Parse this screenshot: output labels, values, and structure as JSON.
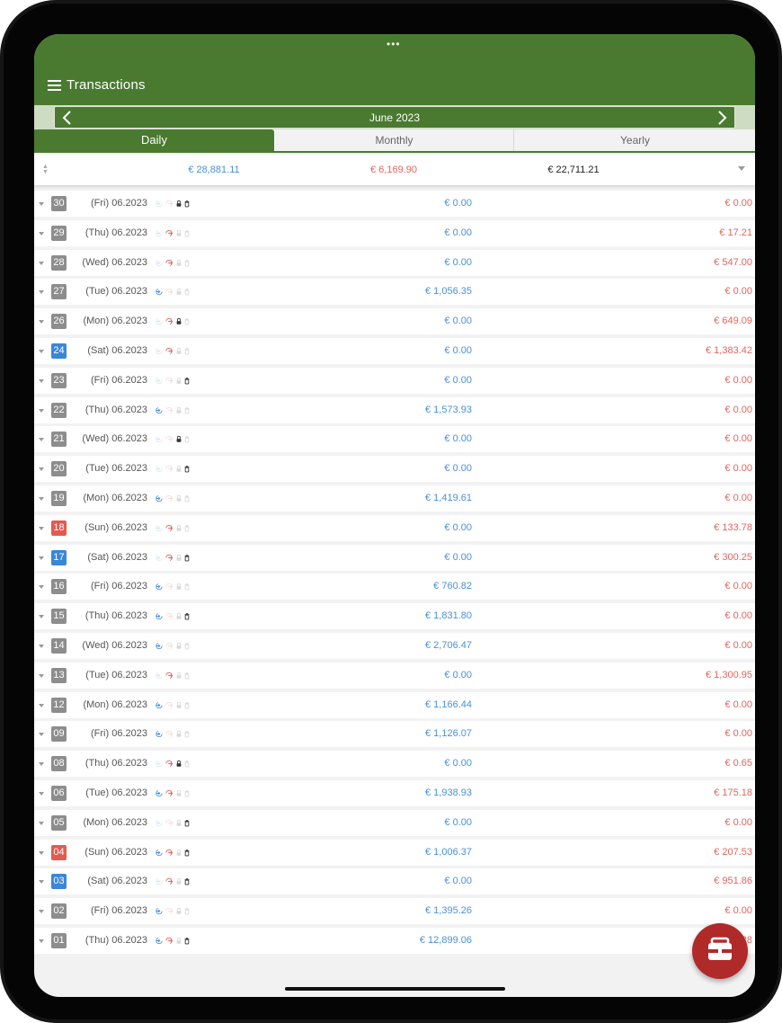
{
  "app": {
    "title": "Transactions"
  },
  "navigation": {
    "month_label": "June 2023"
  },
  "tabs": [
    {
      "label": "Daily",
      "selected": true
    },
    {
      "label": "Monthly",
      "selected": false
    },
    {
      "label": "Yearly",
      "selected": false
    }
  ],
  "summary": {
    "income": "€ 28,881.11",
    "expense": "€ 6,169.90",
    "total": "€ 22,711.21"
  },
  "colors": {
    "brand": "#4a7a30",
    "income": "#4a90d9",
    "expense": "#e0665e",
    "saturday": "#3a86d8",
    "sunday": "#e45a50",
    "fab": "#b02a2a"
  },
  "icons": {
    "menu": "hamburger-menu-icon",
    "prev": "chevron-left-icon",
    "next": "chevron-right-icon",
    "sort": "sort-arrows-icon",
    "dropdown": "caret-down-icon",
    "income": "income-arrow-icon",
    "expense": "expense-arrow-icon",
    "lock": "lock-icon",
    "trash": "trash-icon",
    "fab": "wallet-icon"
  },
  "rows": [
    {
      "day": "30",
      "date": "(Fri) 06.2023",
      "income": "€ 0.00",
      "expense": "€ 0.00",
      "day_type": "weekday",
      "icons": {
        "in": false,
        "out": false,
        "lock": true,
        "trash": true
      }
    },
    {
      "day": "29",
      "date": "(Thu) 06.2023",
      "income": "€ 0.00",
      "expense": "€ 17.21",
      "day_type": "weekday",
      "icons": {
        "in": false,
        "out": true,
        "lock": false,
        "trash": false
      }
    },
    {
      "day": "28",
      "date": "(Wed) 06.2023",
      "income": "€ 0.00",
      "expense": "€ 547.00",
      "day_type": "weekday",
      "icons": {
        "in": false,
        "out": true,
        "lock": false,
        "trash": false
      }
    },
    {
      "day": "27",
      "date": "(Tue) 06.2023",
      "income": "€ 1,056.35",
      "expense": "€ 0.00",
      "day_type": "weekday",
      "icons": {
        "in": true,
        "out": false,
        "lock": false,
        "trash": false
      }
    },
    {
      "day": "26",
      "date": "(Mon) 06.2023",
      "income": "€ 0.00",
      "expense": "€ 649.09",
      "day_type": "weekday",
      "icons": {
        "in": false,
        "out": true,
        "lock": true,
        "trash": false
      }
    },
    {
      "day": "24",
      "date": "(Sat) 06.2023",
      "income": "€ 0.00",
      "expense": "€ 1,383.42",
      "day_type": "saturday",
      "icons": {
        "in": false,
        "out": true,
        "lock": false,
        "trash": false
      }
    },
    {
      "day": "23",
      "date": "(Fri) 06.2023",
      "income": "€ 0.00",
      "expense": "€ 0.00",
      "day_type": "weekday",
      "icons": {
        "in": false,
        "out": false,
        "lock": false,
        "trash": true
      }
    },
    {
      "day": "22",
      "date": "(Thu) 06.2023",
      "income": "€ 1,573.93",
      "expense": "€ 0.00",
      "day_type": "weekday",
      "icons": {
        "in": true,
        "out": false,
        "lock": false,
        "trash": false
      }
    },
    {
      "day": "21",
      "date": "(Wed) 06.2023",
      "income": "€ 0.00",
      "expense": "€ 0.00",
      "day_type": "weekday",
      "icons": {
        "in": false,
        "out": false,
        "lock": true,
        "trash": false
      }
    },
    {
      "day": "20",
      "date": "(Tue) 06.2023",
      "income": "€ 0.00",
      "expense": "€ 0.00",
      "day_type": "weekday",
      "icons": {
        "in": false,
        "out": false,
        "lock": false,
        "trash": true
      }
    },
    {
      "day": "19",
      "date": "(Mon) 06.2023",
      "income": "€ 1,419.61",
      "expense": "€ 0.00",
      "day_type": "weekday",
      "icons": {
        "in": true,
        "out": false,
        "lock": false,
        "trash": false
      }
    },
    {
      "day": "18",
      "date": "(Sun) 06.2023",
      "income": "€ 0.00",
      "expense": "€ 133.78",
      "day_type": "sunday",
      "icons": {
        "in": false,
        "out": true,
        "lock": false,
        "trash": false
      }
    },
    {
      "day": "17",
      "date": "(Sat) 06.2023",
      "income": "€ 0.00",
      "expense": "€ 300.25",
      "day_type": "saturday",
      "icons": {
        "in": false,
        "out": true,
        "lock": false,
        "trash": true
      }
    },
    {
      "day": "16",
      "date": "(Fri) 06.2023",
      "income": "€ 760.82",
      "expense": "€ 0.00",
      "day_type": "weekday",
      "icons": {
        "in": true,
        "out": false,
        "lock": false,
        "trash": false
      }
    },
    {
      "day": "15",
      "date": "(Thu) 06.2023",
      "income": "€ 1,831.80",
      "expense": "€ 0.00",
      "day_type": "weekday",
      "icons": {
        "in": true,
        "out": false,
        "lock": false,
        "trash": true
      }
    },
    {
      "day": "14",
      "date": "(Wed) 06.2023",
      "income": "€ 2,706.47",
      "expense": "€ 0.00",
      "day_type": "weekday",
      "icons": {
        "in": true,
        "out": false,
        "lock": false,
        "trash": false
      }
    },
    {
      "day": "13",
      "date": "(Tue) 06.2023",
      "income": "€ 0.00",
      "expense": "€ 1,300.95",
      "day_type": "weekday",
      "icons": {
        "in": false,
        "out": true,
        "lock": false,
        "trash": false
      }
    },
    {
      "day": "12",
      "date": "(Mon) 06.2023",
      "income": "€ 1,166.44",
      "expense": "€ 0.00",
      "day_type": "weekday",
      "icons": {
        "in": true,
        "out": false,
        "lock": false,
        "trash": false
      }
    },
    {
      "day": "09",
      "date": "(Fri) 06.2023",
      "income": "€ 1,126.07",
      "expense": "€ 0.00",
      "day_type": "weekday",
      "icons": {
        "in": true,
        "out": false,
        "lock": false,
        "trash": false
      }
    },
    {
      "day": "08",
      "date": "(Thu) 06.2023",
      "income": "€ 0.00",
      "expense": "€ 0.65",
      "day_type": "weekday",
      "icons": {
        "in": false,
        "out": true,
        "lock": true,
        "trash": false
      }
    },
    {
      "day": "06",
      "date": "(Tue) 06.2023",
      "income": "€ 1,938.93",
      "expense": "€ 175.18",
      "day_type": "weekday",
      "icons": {
        "in": true,
        "out": true,
        "lock": false,
        "trash": false
      }
    },
    {
      "day": "05",
      "date": "(Mon) 06.2023",
      "income": "€ 0.00",
      "expense": "€ 0.00",
      "day_type": "weekday",
      "icons": {
        "in": false,
        "out": false,
        "lock": false,
        "trash": true
      }
    },
    {
      "day": "04",
      "date": "(Sun) 06.2023",
      "income": "€ 1,006.37",
      "expense": "€ 207.53",
      "day_type": "sunday",
      "icons": {
        "in": true,
        "out": true,
        "lock": false,
        "trash": true
      }
    },
    {
      "day": "03",
      "date": "(Sat) 06.2023",
      "income": "€ 0.00",
      "expense": "€ 951.86",
      "day_type": "saturday",
      "icons": {
        "in": false,
        "out": true,
        "lock": false,
        "trash": true
      }
    },
    {
      "day": "02",
      "date": "(Fri) 06.2023",
      "income": "€ 1,395.26",
      "expense": "€ 0.00",
      "day_type": "weekday",
      "icons": {
        "in": true,
        "out": false,
        "lock": false,
        "trash": false
      }
    },
    {
      "day": "01",
      "date": "(Thu) 06.2023",
      "income": "€ 12,899.06",
      "expense": "€ 4,643.28",
      "day_type": "weekday",
      "icons": {
        "in": true,
        "out": true,
        "lock": false,
        "trash": true
      }
    }
  ]
}
